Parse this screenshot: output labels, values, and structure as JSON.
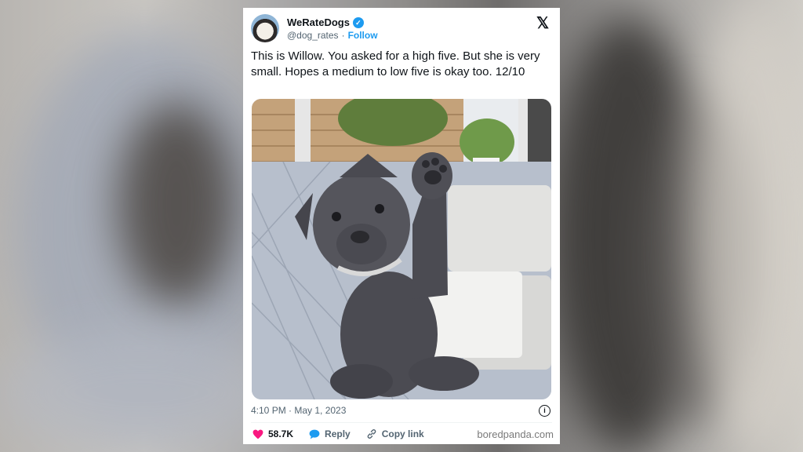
{
  "tweet": {
    "display_name": "WeRateDogs",
    "handle": "@dog_rates",
    "separator": "·",
    "follow_label": "Follow",
    "text": "This is Willow. You asked for a high five. But she is very small. Hopes a medium to low five is okay too. 12/10",
    "timestamp": "4:10 PM · May 1, 2023",
    "likes": "58.7K",
    "reply_label": "Reply",
    "copy_link_label": "Copy link"
  },
  "watermark": "boredpanda.com",
  "icons": {
    "verified": "verified-badge-icon",
    "platform": "x-logo-icon",
    "info": "info-icon",
    "like": "heart-icon",
    "reply": "speech-bubble-icon",
    "copy_link": "link-icon"
  },
  "colors": {
    "accent": "#1d9bf0",
    "like": "#f91880",
    "text": "#0f1419",
    "muted": "#536471"
  }
}
